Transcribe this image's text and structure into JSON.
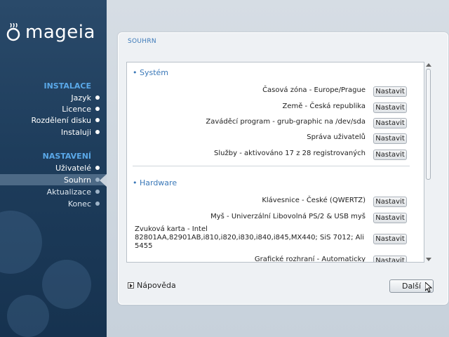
{
  "brand": {
    "name": "mageia"
  },
  "sidebar": {
    "sections": [
      {
        "title": "INSTALACE",
        "items": [
          {
            "label": "Jazyk",
            "state": "done"
          },
          {
            "label": "Licence",
            "state": "done"
          },
          {
            "label": "Rozdělení disku",
            "state": "done"
          },
          {
            "label": "Instaluji",
            "state": "done"
          }
        ]
      },
      {
        "title": "NASTAVENÍ",
        "items": [
          {
            "label": "Uživatelé",
            "state": "done"
          },
          {
            "label": "Souhrn",
            "state": "active"
          },
          {
            "label": "Aktualizace",
            "state": "pending"
          },
          {
            "label": "Konec",
            "state": "pending"
          }
        ]
      }
    ]
  },
  "panel": {
    "title": "SOUHRN"
  },
  "groups": {
    "system": {
      "title": "• Systém",
      "rows": [
        {
          "label": "Časová zóna - Europe/Prague",
          "button": "Nastavit"
        },
        {
          "label": "Země - Česká republika",
          "button": "Nastavit"
        },
        {
          "label": "Zaváděcí program - grub-graphic na /dev/sda",
          "button": "Nastavit"
        },
        {
          "label": "Správa uživatelů",
          "button": "Nastavit"
        },
        {
          "label": "Služby - aktivováno 17 z 28 registrovaných",
          "button": "Nastavit"
        }
      ]
    },
    "hardware": {
      "title": "• Hardware",
      "rows": [
        {
          "label": "Klávesnice - České (QWERTZ)",
          "button": "Nastavit"
        },
        {
          "label": "Myš - Univerzální Libovolná PS/2 & USB myš",
          "button": "Nastavit"
        },
        {
          "label": "Zvuková karta - Intel 82801AA,82901AB,i810,i820,i830,i840,i845,MX440; SiS 7012; Ali 5455",
          "button": "Nastavit"
        },
        {
          "label": "Grafické rozhraní - Automaticky",
          "button": "Nastavit"
        }
      ]
    }
  },
  "footer": {
    "help_label": "Nápověda",
    "next_label": "Další"
  },
  "colors": {
    "accent": "#3a78b8",
    "sidebar_bg": "#1e3d5c",
    "sidebar_section": "#5aa8e8"
  }
}
